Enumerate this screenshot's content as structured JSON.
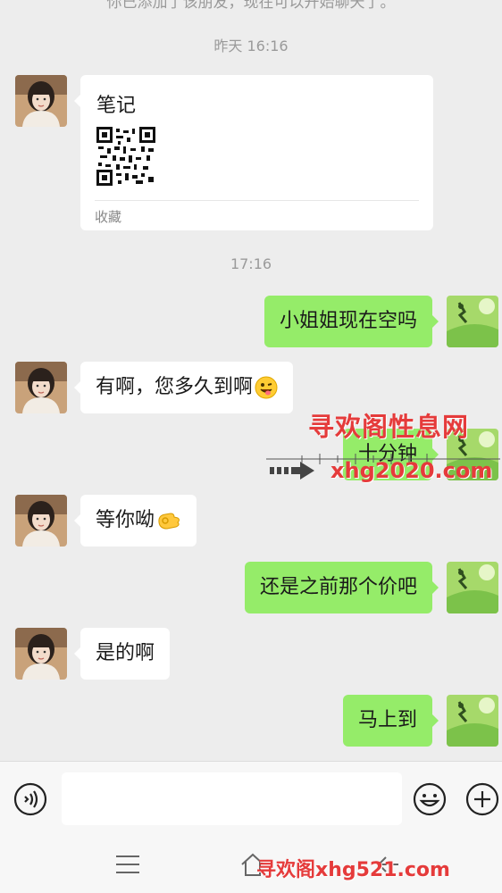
{
  "chat": {
    "cutoff_text": "你已添加了该朋友，现在可以开始聊天了。",
    "timestamps": [
      "昨天 16:16",
      "17:16"
    ],
    "card": {
      "title": "笔记",
      "footer": "收藏"
    },
    "messages": [
      {
        "side": "out",
        "text": "小姐姐现在空吗"
      },
      {
        "side": "in",
        "text": "有啊，您多久到啊",
        "emoji": "winking-face-tongue"
      },
      {
        "side": "out",
        "text": "十分钟"
      },
      {
        "side": "in",
        "text": "等你呦",
        "emoji": "ok-hand"
      },
      {
        "side": "out",
        "text": "还是之前那个价吧"
      },
      {
        "side": "in",
        "text": "是的啊"
      },
      {
        "side": "out",
        "text": "马上到"
      }
    ]
  },
  "watermarks": {
    "line1": "寻欢阁性息网",
    "line2": "xhg2020.com",
    "bottom": "寻欢阁xhg521.com"
  },
  "inputbar": {
    "voice_icon": "voice-icon",
    "emoji_icon": "emoji-icon",
    "plus_icon": "plus-icon",
    "text_value": ""
  },
  "navbar": {
    "menu_icon": "menu-icon",
    "home_icon": "home-icon",
    "back_icon": "back-icon"
  },
  "colors": {
    "background": "#ededed",
    "incoming_bubble": "#ffffff",
    "outgoing_bubble": "#95ec69",
    "watermark": "#e53b3b"
  }
}
